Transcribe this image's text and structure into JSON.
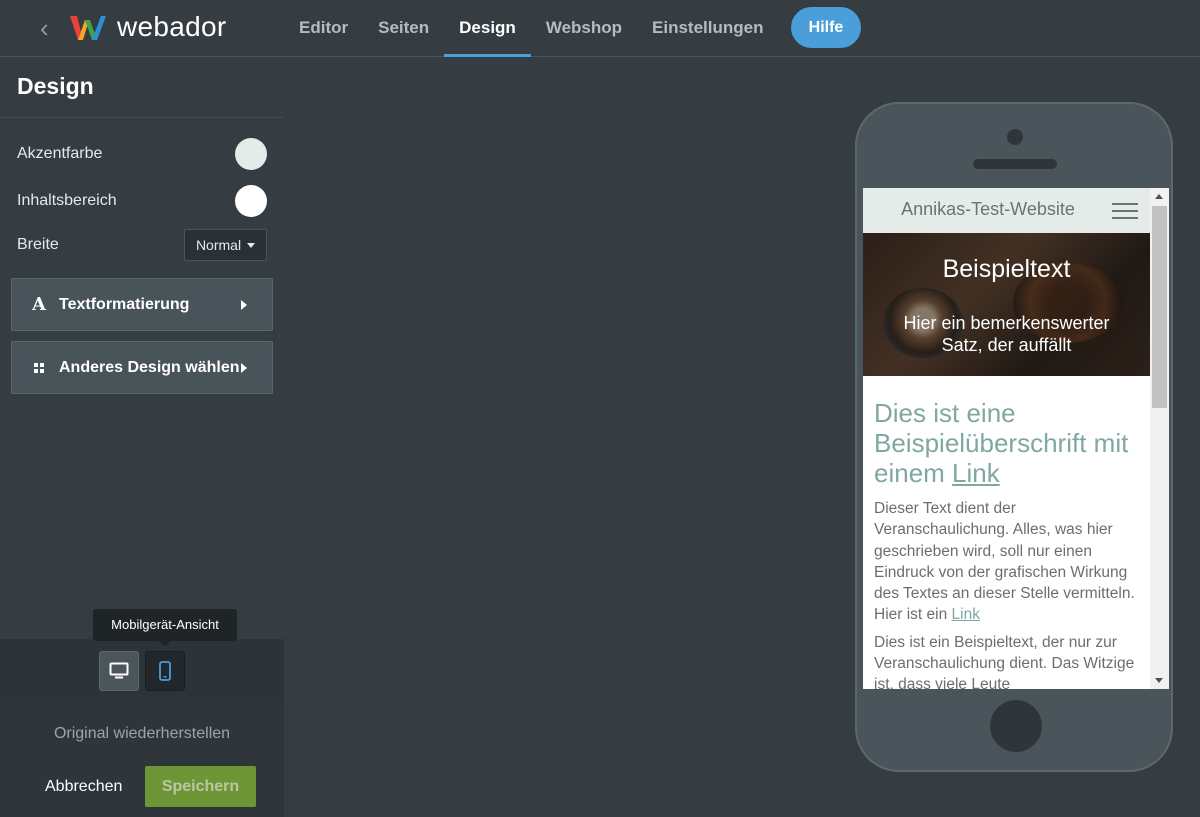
{
  "topbar": {
    "logo_text": "webador",
    "nav": [
      "Editor",
      "Seiten",
      "Design",
      "Webshop",
      "Einstellungen"
    ],
    "active_nav": "Design",
    "help_label": "Hilfe"
  },
  "sidebar": {
    "title": "Design",
    "accent_label": "Akzentfarbe",
    "accent_color": "#e4ebe8",
    "content_label": "Inhaltsbereich",
    "content_color": "#ffffff",
    "width_label": "Breite",
    "width_value": "Normal",
    "text_format_label": "Textformatierung",
    "text_format_icon": "A",
    "other_design_label": "Anderes Design wählen",
    "tooltip": "Mobilgerät-Ansicht",
    "restore_label": "Original wiederherstellen",
    "cancel_label": "Abbrechen",
    "save_label": "Speichern"
  },
  "preview": {
    "site_title": "Annikas-Test-Website",
    "hero_title": "Beispieltext",
    "hero_subtitle": "Hier ein bemerkenswerter Satz, der auffällt",
    "heading_text": "Dies ist eine Beispielüberschrift mit einem ",
    "heading_link": "Link",
    "para1_text": "Dieser Text dient der Veranschaulichung. Alles, was hier geschrieben wird, soll nur einen Eindruck von der grafischen Wirkung des Textes an dieser Stelle vermitteln. Hier ist ein ",
    "para1_link": "Link",
    "para2_text": "Dies ist ein Beispieltext, der nur zur Veranschaulichung dient. Das Witzige ist, dass viele Leute"
  },
  "colors": {
    "accent": "#4a9ed9",
    "save": "#6e9637",
    "heading": "#7fa8a2"
  }
}
